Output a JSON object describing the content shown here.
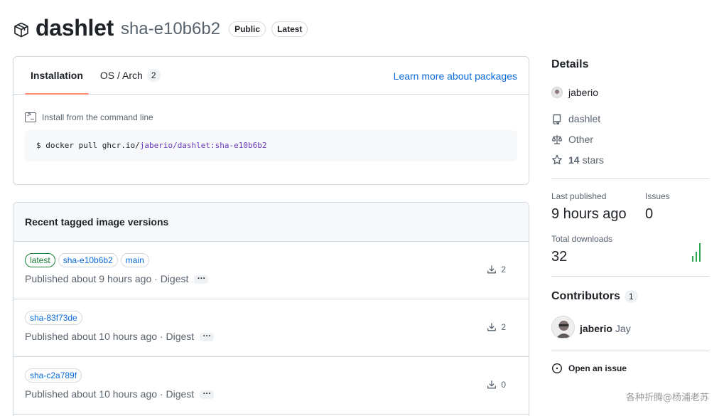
{
  "header": {
    "name": "dashlet",
    "tag": "sha-e10b6b2",
    "badges": [
      "Public",
      "Latest"
    ]
  },
  "install": {
    "tabs": [
      {
        "label": "Installation"
      },
      {
        "label": "OS / Arch",
        "count": "2"
      }
    ],
    "learn_more": "Learn more about packages",
    "label": "Install from the command line",
    "command_prefix": "$ docker pull ghcr.io/",
    "command_user": "jaberio",
    "command_slash": "/",
    "command_image": "dashlet:sha-e10b6b2"
  },
  "versions": {
    "title": "Recent tagged image versions",
    "rows": [
      {
        "tags": [
          "latest",
          "sha-e10b6b2",
          "main"
        ],
        "published": "Published about 9 hours ago · Digest",
        "downloads": "2"
      },
      {
        "tags": [
          "sha-83f73de"
        ],
        "published": "Published about 10 hours ago · Digest",
        "downloads": "2"
      },
      {
        "tags": [
          "sha-c2a789f"
        ],
        "published": "Published about 10 hours ago · Digest",
        "downloads": "0"
      }
    ]
  },
  "sidebar": {
    "details_title": "Details",
    "owner": "jaberio",
    "repo": "dashlet",
    "license": "Other",
    "stars_count": "14",
    "stars_label": "stars",
    "last_published_label": "Last published",
    "last_published_value": "9 hours ago",
    "issues_label": "Issues",
    "issues_value": "0",
    "total_downloads_label": "Total downloads",
    "total_downloads_value": "32",
    "contributors_title": "Contributors",
    "contributors_count": "1",
    "contributor_login": "jaberio",
    "contributor_name": "Jay",
    "open_issue": "Open an issue"
  },
  "watermark": "各种折腾@杨浦老苏",
  "colors": {
    "accent": "#0969da",
    "tab_underline": "#fd8c73",
    "latest_green": "#1a7f37",
    "muted": "#59636e",
    "border": "#d1d9e0"
  }
}
